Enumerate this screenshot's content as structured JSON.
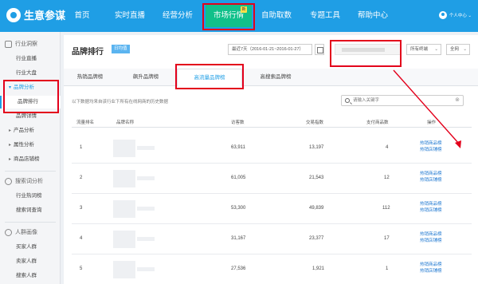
{
  "app": {
    "logo_text": "生意参谋"
  },
  "nav": {
    "items": [
      {
        "label": "首页"
      },
      {
        "label": "实时直播"
      },
      {
        "label": "经营分析"
      },
      {
        "label": "市场行情",
        "badge": "新"
      },
      {
        "label": "自助取数"
      },
      {
        "label": "专题工具"
      },
      {
        "label": "帮助中心"
      }
    ],
    "user_label": "个人中心 ⌄"
  },
  "sidebar": {
    "section_industry": "行业洞察",
    "industry_live": "行业直播",
    "industry_overview": "行业大盘",
    "brand_analysis": "品牌分析",
    "brand_rank": "品牌排行",
    "brand_detail": "品牌详情",
    "product_analysis": "产品分析",
    "attr_analysis": "属性分析",
    "product_shop": "商品店铺榜",
    "section_search": "搜索词分析",
    "hot_words": "行业热词榜",
    "word_query": "搜索词查询",
    "section_crowd": "人群画像",
    "buyer": "买家人群",
    "seller": "卖家人群",
    "searcher": "搜索人群"
  },
  "main": {
    "title": "品牌排行",
    "title_tag": "日均值",
    "date_range": "最近7天（2016-01-21~2016-01-27）",
    "terminal": "所有终端",
    "region": "全网",
    "tabs": [
      {
        "label": "热销品牌榜"
      },
      {
        "label": "飙升品牌榜"
      },
      {
        "label": "高流量品牌榜"
      },
      {
        "label": "高搜索品牌榜"
      }
    ],
    "note": "以下数据均来自该行业下所有在线网商的历史数据",
    "search_placeholder": "请输入关键字",
    "columns": [
      "流量排名",
      "品牌名称",
      "访客数",
      "交易指数",
      "支付商品数",
      "操作"
    ],
    "rows": [
      {
        "rank": "1",
        "visitors": "63,911",
        "trade": "13,197",
        "paid": "4",
        "op1": "热销商品榜",
        "op2": "热销店铺榜"
      },
      {
        "rank": "2",
        "visitors": "61,005",
        "trade": "21,543",
        "paid": "12",
        "op1": "热销商品榜",
        "op2": "热销店铺榜"
      },
      {
        "rank": "3",
        "visitors": "53,300",
        "trade": "49,839",
        "paid": "112",
        "op1": "热销商品榜",
        "op2": "热销店铺榜"
      },
      {
        "rank": "4",
        "visitors": "31,167",
        "trade": "23,377",
        "paid": "17",
        "op1": "热销商品榜",
        "op2": "热销店铺榜"
      },
      {
        "rank": "5",
        "visitors": "27,536",
        "trade": "1,921",
        "paid": "1",
        "op1": "热销商品榜",
        "op2": "热销店铺榜"
      }
    ]
  },
  "colors": {
    "nav_bg": "#1f9ee5",
    "active_nav": "#10c08a",
    "highlight": "#e3001b",
    "link": "#1f78d1"
  }
}
